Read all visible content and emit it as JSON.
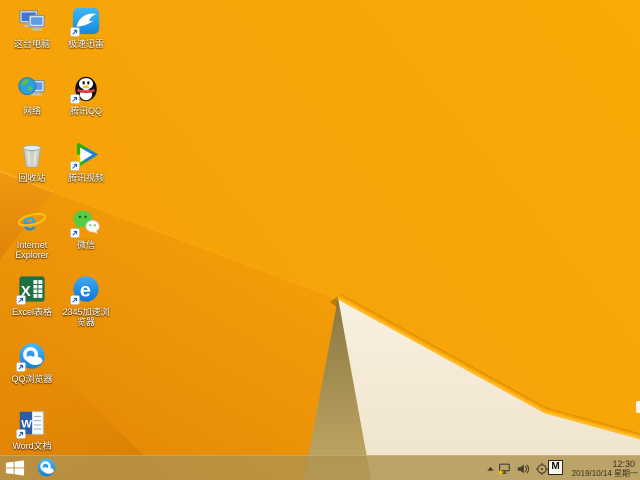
{
  "wallpaper": {
    "base_color": "#F7A50A",
    "deep_orange_facet": "#E2840A",
    "tan_facet": "#A8914F",
    "cream_facet": "#F3E9D4",
    "crease_highlight": "#FFBA25"
  },
  "desktop_icons": [
    {
      "id": "this-pc",
      "label": "这台电脑",
      "shortcut": false
    },
    {
      "id": "xunlei",
      "label": "极速迅雷",
      "shortcut": true
    },
    {
      "id": "network",
      "label": "网络",
      "shortcut": false
    },
    {
      "id": "tencent-qq",
      "label": "腾讯QQ",
      "shortcut": true
    },
    {
      "id": "recycle-bin",
      "label": "回收站",
      "shortcut": false
    },
    {
      "id": "tencent-video",
      "label": "腾讯视频",
      "shortcut": true
    },
    {
      "id": "internet-explorer",
      "label": "Internet Explorer",
      "shortcut": false
    },
    {
      "id": "wechat",
      "label": "微信",
      "shortcut": true
    },
    {
      "id": "excel",
      "label": "Excel表格",
      "shortcut": true
    },
    {
      "id": "browser-2345",
      "label": "2345加速浏览器",
      "shortcut": true
    },
    {
      "id": "qq-browser",
      "label": "QQ浏览器",
      "shortcut": true
    },
    {
      "id": "word",
      "label": "Word文档",
      "shortcut": true
    }
  ],
  "taskbar": {
    "tray": {
      "ime_label": "M",
      "time": "12:30",
      "date": "2019/10/14 星期一"
    }
  }
}
